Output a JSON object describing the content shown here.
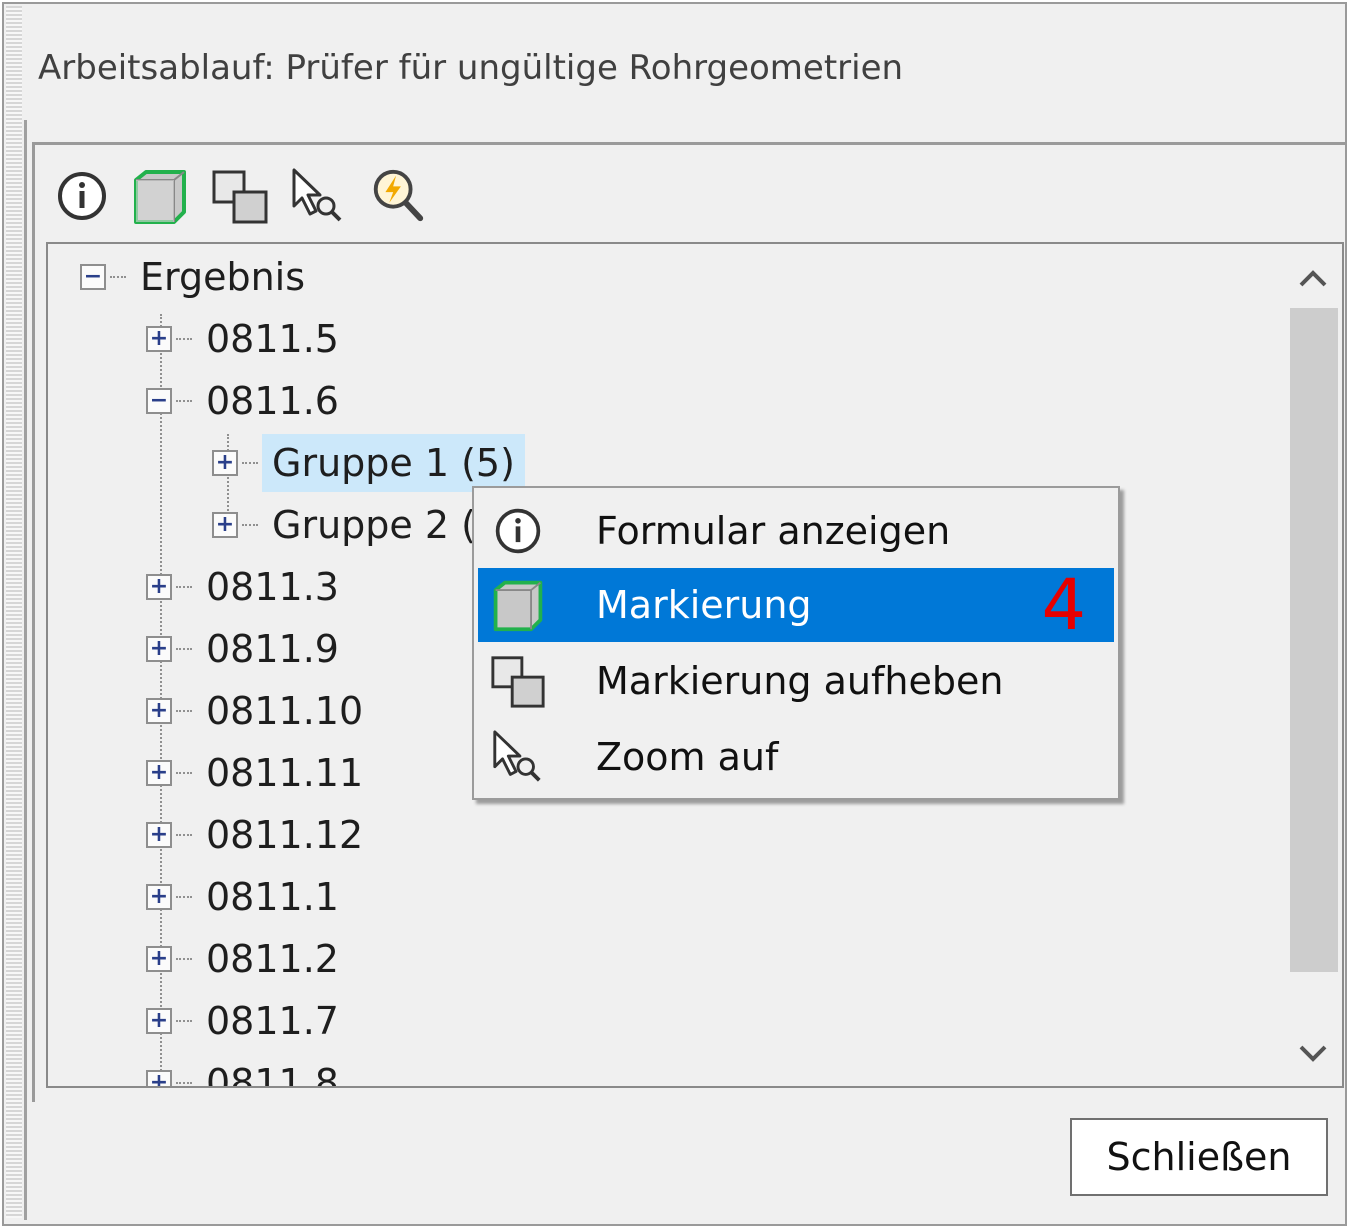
{
  "window": {
    "title": "Arbeitsablauf: Prüfer für ungültige Rohrgeometrien"
  },
  "toolbar": {
    "icons": [
      "info-icon",
      "cube-icon",
      "two-cubes-icon",
      "zoom-cursor-icon",
      "lightning-magnifier-icon"
    ]
  },
  "tree": {
    "root": {
      "label": "Ergebnis",
      "expanded": true
    },
    "items": [
      {
        "label": "0811.5",
        "expanded": false
      },
      {
        "label": "0811.6",
        "expanded": true
      },
      {
        "label": "Gruppe 1 (5)",
        "expanded": false,
        "selected": true
      },
      {
        "label": "Gruppe 2 (1",
        "expanded": false
      },
      {
        "label": "0811.3",
        "expanded": false
      },
      {
        "label": "0811.9",
        "expanded": false
      },
      {
        "label": "0811.10",
        "expanded": false
      },
      {
        "label": "0811.11",
        "expanded": false
      },
      {
        "label": "0811.12",
        "expanded": false
      },
      {
        "label": "0811.1",
        "expanded": false
      },
      {
        "label": "0811.2",
        "expanded": false
      },
      {
        "label": "0811.7",
        "expanded": false
      },
      {
        "label": "0811.8",
        "expanded": false
      }
    ]
  },
  "context_menu": {
    "items": [
      {
        "label": "Formular anzeigen",
        "icon": "info-icon"
      },
      {
        "label": "Markierung",
        "icon": "cube-icon",
        "highlighted": true,
        "badge": "4"
      },
      {
        "label": "Markierung aufheben",
        "icon": "two-cubes-icon"
      },
      {
        "label": "Zoom auf",
        "icon": "zoom-cursor-icon"
      }
    ]
  },
  "buttons": {
    "close": "Schließen"
  },
  "colors": {
    "highlight": "#0078d7",
    "selection": "#cce8fa",
    "badge": "#e60000",
    "cube_border": "#22b14c"
  }
}
